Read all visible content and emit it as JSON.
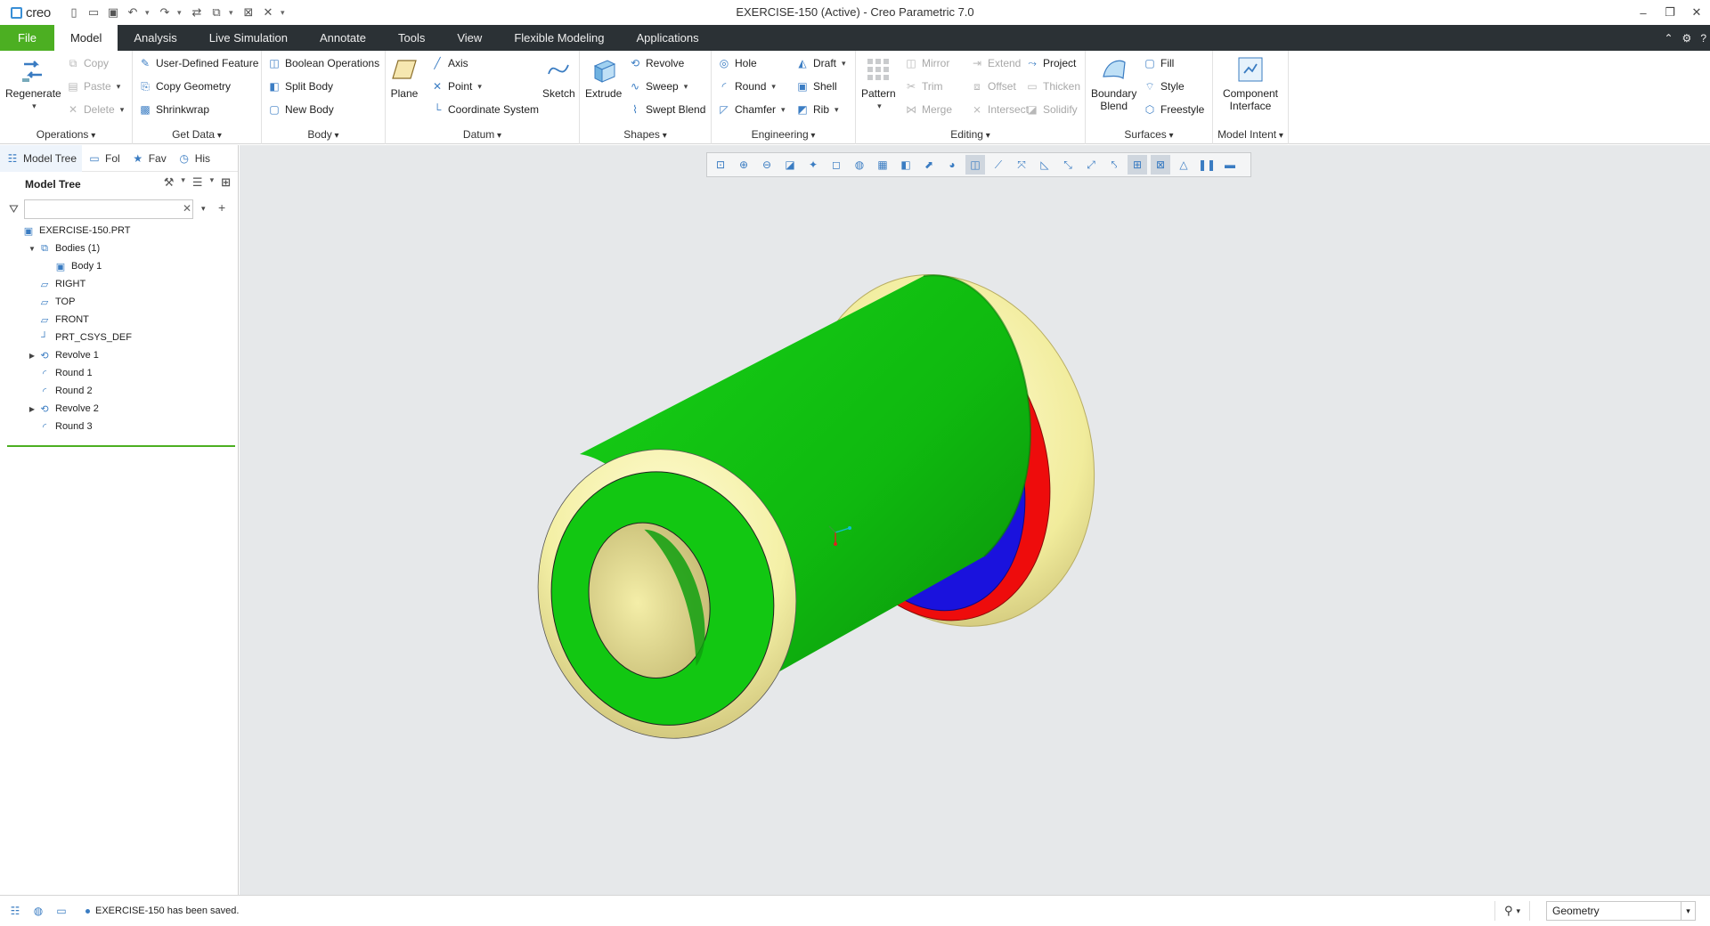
{
  "app": {
    "logo_text": "creo",
    "window_title": "EXERCISE-150 (Active) - Creo Parametric 7.0"
  },
  "tabs": [
    {
      "label": "File"
    },
    {
      "label": "Model"
    },
    {
      "label": "Analysis"
    },
    {
      "label": "Live Simulation"
    },
    {
      "label": "Annotate"
    },
    {
      "label": "Tools"
    },
    {
      "label": "View"
    },
    {
      "label": "Flexible Modeling"
    },
    {
      "label": "Applications"
    }
  ],
  "ribbon": {
    "operations": {
      "label": "Operations",
      "regenerate": "Regenerate",
      "copy": "Copy",
      "paste": "Paste",
      "delete": "Delete"
    },
    "getdata": {
      "label": "Get Data",
      "udf": "User-Defined Feature",
      "copy_geometry": "Copy Geometry",
      "shrinkwrap": "Shrinkwrap"
    },
    "body": {
      "label": "Body",
      "boolean": "Boolean Operations",
      "split": "Split Body",
      "new": "New Body"
    },
    "datum": {
      "label": "Datum",
      "plane": "Plane",
      "axis": "Axis",
      "point": "Point",
      "csys": "Coordinate System",
      "sketch": "Sketch"
    },
    "shapes": {
      "label": "Shapes",
      "extrude": "Extrude",
      "revolve": "Revolve",
      "sweep": "Sweep",
      "swept_blend": "Swept Blend"
    },
    "engineering": {
      "label": "Engineering",
      "hole": "Hole",
      "round": "Round",
      "chamfer": "Chamfer",
      "draft": "Draft",
      "shell": "Shell",
      "rib": "Rib"
    },
    "editing": {
      "label": "Editing",
      "pattern": "Pattern",
      "mirror": "Mirror",
      "trim": "Trim",
      "merge": "Merge",
      "extend": "Extend",
      "offset": "Offset",
      "intersect": "Intersect",
      "project": "Project",
      "thicken": "Thicken",
      "solidify": "Solidify"
    },
    "surfaces": {
      "label": "Surfaces",
      "boundary_blend_1": "Boundary",
      "boundary_blend_2": "Blend",
      "fill": "Fill",
      "style": "Style",
      "freestyle": "Freestyle"
    },
    "model_intent": {
      "label": "Model Intent",
      "component_interface_1": "Component",
      "component_interface_2": "Interface"
    }
  },
  "panel": {
    "tabs": [
      "Model Tree",
      "Fol",
      "Fav",
      "His"
    ],
    "tree_title": "Model Tree",
    "filter_placeholder": ""
  },
  "tree": [
    {
      "label": "EXERCISE-150.PRT",
      "indent": 0,
      "expander": "",
      "icon": "part-icon"
    },
    {
      "label": "Bodies (1)",
      "indent": 1,
      "expander": "▼",
      "icon": "bodies-icon"
    },
    {
      "label": "Body 1",
      "indent": 2,
      "expander": "",
      "icon": "body-icon"
    },
    {
      "label": "RIGHT",
      "indent": 1,
      "expander": "",
      "icon": "datum-plane-icon"
    },
    {
      "label": "TOP",
      "indent": 1,
      "expander": "",
      "icon": "datum-plane-icon"
    },
    {
      "label": "FRONT",
      "indent": 1,
      "expander": "",
      "icon": "datum-plane-icon"
    },
    {
      "label": "PRT_CSYS_DEF",
      "indent": 1,
      "expander": "",
      "icon": "csys-icon"
    },
    {
      "label": "Revolve 1",
      "indent": 1,
      "expander": "▶",
      "icon": "revolve-icon"
    },
    {
      "label": "Round 1",
      "indent": 1,
      "expander": "",
      "icon": "round-icon"
    },
    {
      "label": "Round 2",
      "indent": 1,
      "expander": "",
      "icon": "round-icon"
    },
    {
      "label": "Revolve 2",
      "indent": 1,
      "expander": "▶",
      "icon": "revolve-icon"
    },
    {
      "label": "Round 3",
      "indent": 1,
      "expander": "",
      "icon": "round-icon"
    }
  ],
  "status": {
    "message": "EXERCISE-150 has been saved.",
    "selection_filter": "Geometry"
  },
  "colors": {
    "file_tab": "#4caf22",
    "model_green": "#12c712",
    "model_yellow": "#f4f0a6",
    "model_red": "#ee0c0c",
    "model_blue": "#1a12dd",
    "accent": "#3a7cc2"
  }
}
